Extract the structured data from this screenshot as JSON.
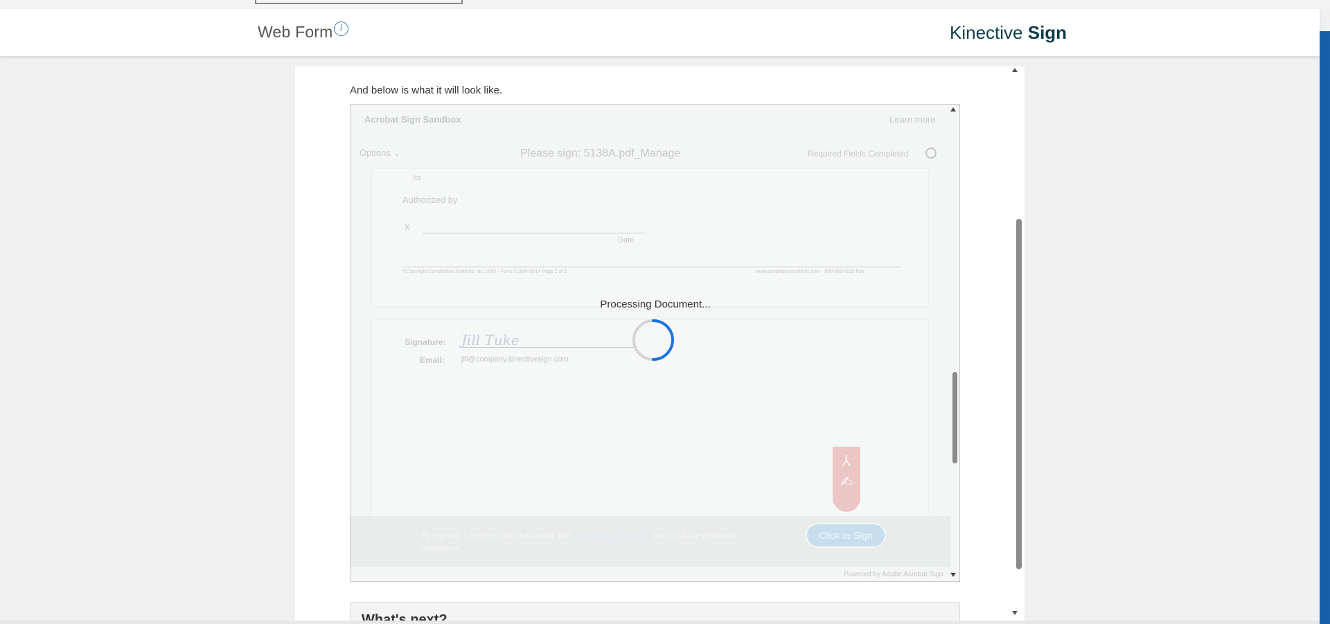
{
  "header": {
    "title": "Web Form",
    "info_icon": "info-icon",
    "brand_light": "Kinective",
    "brand_bold": "Sign"
  },
  "content": {
    "intro": "And below is what it will look like."
  },
  "document_frame": {
    "app_name": "Acrobat Sign Sandbox",
    "learn_more": "Learn more",
    "options": "Options ⌄",
    "doc_title": "Please sign: 5138A.pdf_Manage",
    "required": "Required Fields Completed",
    "page": {
      "its": "Its",
      "authorized_by": "Authorized by",
      "x_mark": "X",
      "date_label": "Date",
      "footer_left": "©Copyright Compliance Systems, Inc. 2005 - Form 5138A  09/14   Page 2 of 3",
      "footer_right": "www.compliancesystems.com · 800-968-8522 Fax"
    },
    "signature": {
      "signature_label": "Signature:",
      "signature_value": "Jill Tuke",
      "email_label": "Email:",
      "email_value": "jill@company.kinectivesign.com"
    },
    "pdf_badge_top": "⅄",
    "pdf_badge_bottom": "✍",
    "sign_bar": {
      "text_before": "By signing, I agree to this document, the ",
      "link": "Consumer Disclosure",
      "text_after": " and to utilize electronic signatures.",
      "button": "Click to Sign"
    },
    "powered_by": "Powered by Adobe Acrobat Sign",
    "processing": "Processing Document..."
  },
  "next": {
    "title": "What's next?"
  },
  "colors": {
    "brand": "#0e3d4e",
    "accent": "#1560a8",
    "spinner": "#1a73e8"
  }
}
